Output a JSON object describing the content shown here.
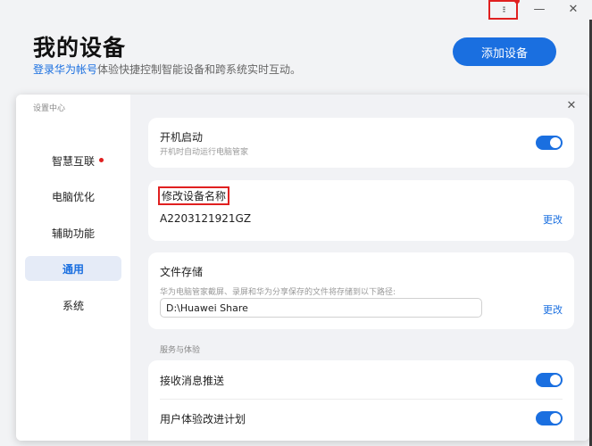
{
  "header": {
    "title": "我的设备",
    "subtitle_link": "登录华为帐号",
    "subtitle_rest": "体验快捷控制智能设备和跨系统实时互动。",
    "add_button": "添加设备"
  },
  "window": {
    "more_glyph": "⁝⁝",
    "min_glyph": "—",
    "close_glyph": "✕"
  },
  "panel": {
    "close_glyph": "✕",
    "sidebar_title": "设置中心",
    "nav": [
      {
        "label": "智慧互联",
        "badge": true
      },
      {
        "label": "电脑优化"
      },
      {
        "label": "辅助功能"
      },
      {
        "label": "通用",
        "active": true
      },
      {
        "label": "系统"
      }
    ]
  },
  "settings": {
    "startup": {
      "title": "开机启动",
      "desc": "开机时自动运行电脑管家",
      "enabled": true
    },
    "rename": {
      "title": "修改设备名称",
      "value": "A2203121921GZ",
      "action": "更改"
    },
    "storage": {
      "title": "文件存储",
      "desc": "华为电脑管家截屏、录屏和华为分享保存的文件将存储到以下路径:",
      "path": "D:\\Huawei Share",
      "action": "更改"
    },
    "section_label": "服务与体验",
    "notifications": {
      "title": "接收消息推送",
      "enabled": true
    },
    "ux_plan": {
      "title": "用户体验改进计划",
      "enabled": true
    }
  },
  "colors": {
    "accent": "#1a6fe0",
    "alert": "#e02020"
  }
}
